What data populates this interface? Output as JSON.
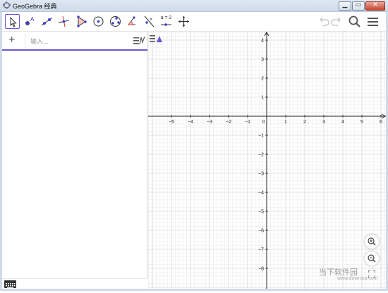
{
  "window": {
    "title": "GeoGebra 经典"
  },
  "window_buttons": {
    "minimize": "▁",
    "maximize": "▭",
    "close": "✕"
  },
  "toolbar": {
    "tools": [
      {
        "name": "move-tool-icon",
        "selected": true
      },
      {
        "name": "point-tool-icon"
      },
      {
        "name": "line-tool-icon"
      },
      {
        "name": "perpendicular-line-tool-icon"
      },
      {
        "name": "polygon-tool-icon"
      },
      {
        "name": "circle-tool-icon"
      },
      {
        "name": "ellipse-tool-icon"
      },
      {
        "name": "angle-tool-icon"
      },
      {
        "name": "reflect-tool-icon"
      },
      {
        "name": "slider-tool-icon",
        "label": "a = 2"
      },
      {
        "name": "move-graphics-view-tool-icon"
      }
    ],
    "undo_icon": "undo-icon",
    "redo_icon": "redo-icon",
    "search_icon": "search-icon",
    "menu_icon": "hamburger-menu-icon"
  },
  "algebra": {
    "add_label": "+",
    "input_placeholder": "输入..."
  },
  "graphics": {
    "x_ticks": [
      "−5",
      "−4",
      "−3",
      "−2",
      "−1",
      "0",
      "1",
      "2",
      "3",
      "4",
      "5",
      "6"
    ],
    "y_ticks": [
      "4",
      "3",
      "2",
      "1",
      "−1",
      "−2",
      "−3",
      "−4",
      "−5",
      "−6",
      "−7",
      "−8"
    ],
    "accent": "#6557d2"
  },
  "watermark": {
    "text": "当下软件园",
    "sub": "www.downxia.com"
  }
}
